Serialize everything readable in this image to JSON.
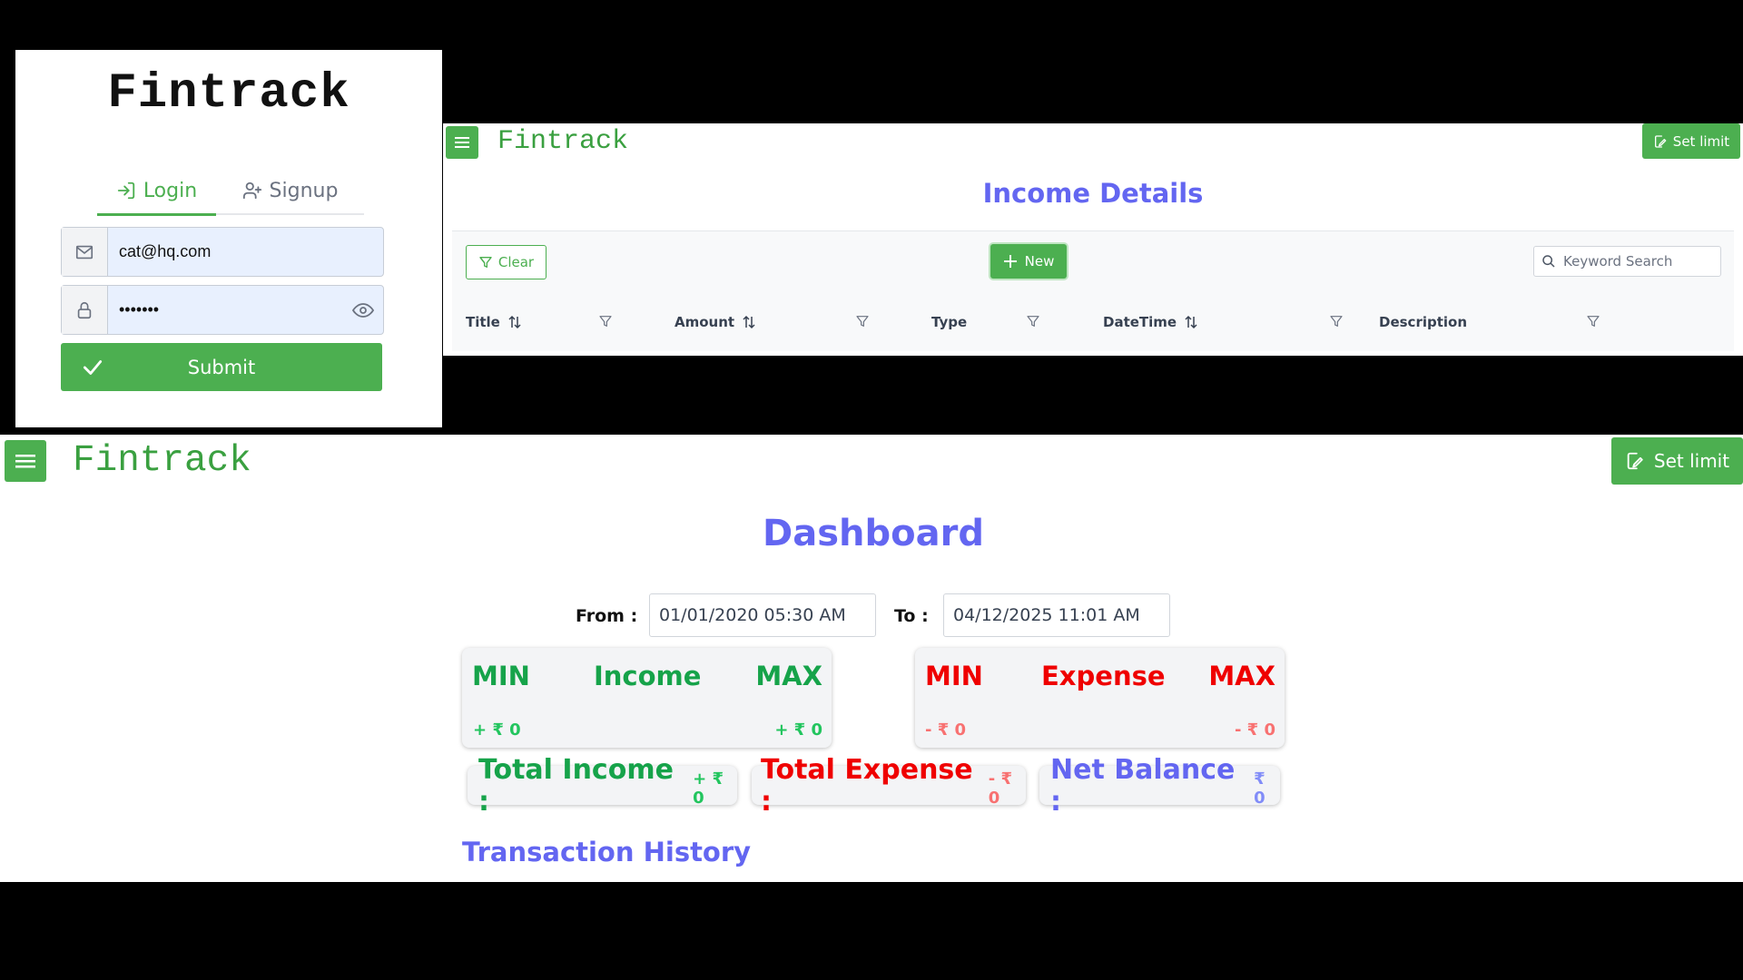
{
  "colors": {
    "brand_green": "#4caf50",
    "accent_purple": "#6366f1",
    "income_green": "#16a34a",
    "expense_red": "#ef0000",
    "light_green": "#22c55e",
    "light_red": "#f87171"
  },
  "login": {
    "app_name": "Fintrack",
    "tabs": [
      {
        "label": "Login",
        "icon": "login-icon",
        "active": true
      },
      {
        "label": "Signup",
        "icon": "user-plus-icon",
        "active": false
      }
    ],
    "email_value": "cat@hq.com",
    "password_value": "•••••••",
    "submit_label": "Submit"
  },
  "income": {
    "app_name": "Fintrack",
    "set_limit_label": "Set limit",
    "title": "Income Details",
    "clear_label": "Clear",
    "new_label": "New",
    "search_placeholder": "Keyword Search",
    "columns": [
      {
        "label": "Title",
        "sortable": true
      },
      {
        "label": "Amount",
        "sortable": true
      },
      {
        "label": "Type",
        "sortable": false
      },
      {
        "label": "DateTime",
        "sortable": true
      },
      {
        "label": "Description",
        "sortable": false
      }
    ]
  },
  "dashboard": {
    "app_name": "Fintrack",
    "set_limit_label": "Set limit",
    "title": "Dashboard",
    "from_label": "From :",
    "from_value": "01/01/2020 05:30 AM",
    "to_label": "To :",
    "to_value": "04/12/2025 11:01 AM",
    "income_card": {
      "min_label": "MIN",
      "title": "Income",
      "max_label": "MAX",
      "min_value": "+ ₹ 0",
      "max_value": "+ ₹ 0"
    },
    "expense_card": {
      "min_label": "MIN",
      "title": "Expense",
      "max_label": "MAX",
      "min_value": "- ₹ 0",
      "max_value": "- ₹ 0"
    },
    "total_income": {
      "label": "Total Income :",
      "value": "+ ₹ 0"
    },
    "total_expense": {
      "label": "Total Expense :",
      "value": "- ₹ 0"
    },
    "net_balance": {
      "label": "Net Balance :",
      "value": "₹ 0"
    },
    "history_title": "Transaction History"
  }
}
